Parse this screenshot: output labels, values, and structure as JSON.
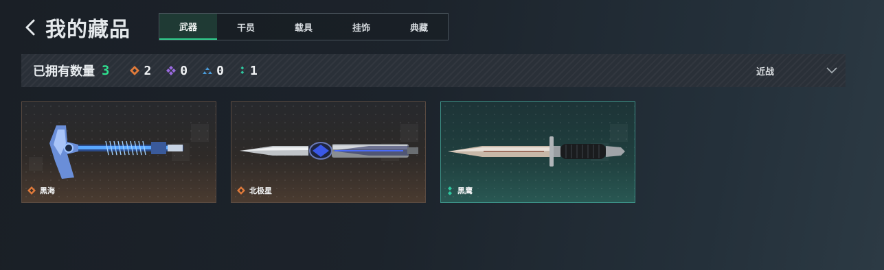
{
  "header": {
    "title": "我的藏品"
  },
  "tabs": [
    {
      "label": "武器",
      "active": true
    },
    {
      "label": "干员",
      "active": false
    },
    {
      "label": "载具",
      "active": false
    },
    {
      "label": "挂饰",
      "active": false
    },
    {
      "label": "典藏",
      "active": false
    }
  ],
  "stats": {
    "owned_label": "已拥有数量",
    "owned_count": "3",
    "rarities": [
      {
        "icon": "orange-diamond-icon",
        "color": "#e07a3a",
        "count": "2"
      },
      {
        "icon": "purple-diamond-icon",
        "color": "#9a6ae0",
        "count": "0"
      },
      {
        "icon": "blue-triangle-icon",
        "color": "#4a9ad8",
        "count": "0"
      },
      {
        "icon": "teal-dots-icon",
        "color": "#2fc8a0",
        "count": "1"
      }
    ]
  },
  "filter": {
    "selected": "近战"
  },
  "items": [
    {
      "name": "黑海",
      "rarity_icon": "orange-diamond-icon",
      "rarity_color": "#e07a3a"
    },
    {
      "name": "北极星",
      "rarity_icon": "orange-diamond-icon",
      "rarity_color": "#e07a3a"
    },
    {
      "name": "黑鹰",
      "rarity_icon": "teal-dots-icon",
      "rarity_color": "#2fc8a0"
    }
  ],
  "colors": {
    "accent": "#2fe08f",
    "tab_active_bg": "#1f3a34"
  }
}
